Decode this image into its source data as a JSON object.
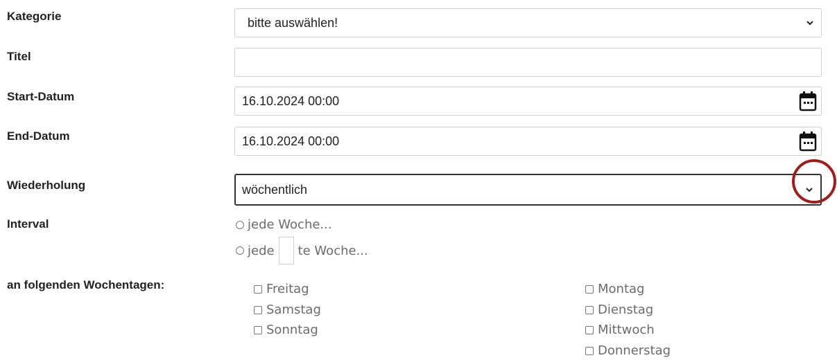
{
  "form": {
    "kategorie": {
      "label": "Kategorie",
      "value": "bitte auswählen!"
    },
    "titel": {
      "label": "Titel",
      "value": ""
    },
    "start": {
      "label": "Start-Datum",
      "value": "16.10.2024 00:00"
    },
    "end": {
      "label": "End-Datum",
      "value": "16.10.2024 00:00"
    },
    "wiederholung": {
      "label": "Wiederholung",
      "value": "wöchentlich"
    },
    "interval": {
      "label": "Interval",
      "option1": "jede Woche...",
      "option2_prefix": "jede",
      "option2_suffix": "te Woche..."
    },
    "wochentage": {
      "label": "an folgenden Wochentagen:",
      "col1": [
        "Freitag",
        "Samstag",
        "Sonntag"
      ],
      "col2": [
        "Montag",
        "Dienstag",
        "Mittwoch",
        "Donnerstag"
      ]
    }
  },
  "icons": {
    "calendar": "calendar-icon",
    "chevron": "chevron-down-icon"
  },
  "colors": {
    "highlight_ring": "#a31c1c",
    "border": "#cfcfcf",
    "active_border": "#333333"
  }
}
